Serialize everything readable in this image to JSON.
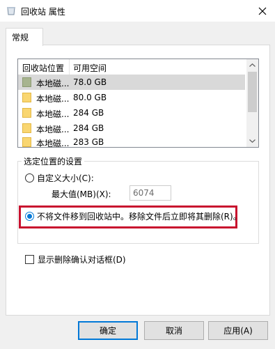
{
  "window": {
    "title": "回收站 属性",
    "icon": "recycle-bin-icon",
    "close": "close-icon"
  },
  "tabs": [
    {
      "label": "常规"
    }
  ],
  "list": {
    "columns": [
      "回收站位置",
      "可用空间"
    ],
    "rows": [
      {
        "name": "本地磁...",
        "space": "78.0 GB",
        "icon": "drive-icon",
        "selected": true
      },
      {
        "name": "本地磁...",
        "space": "80.0 GB",
        "icon": "drive-icon"
      },
      {
        "name": "本地磁...",
        "space": "284 GB",
        "icon": "drive-icon"
      },
      {
        "name": "本地磁...",
        "space": "284 GB",
        "icon": "drive-icon"
      },
      {
        "name": "本地磁...",
        "space": "283 GB",
        "icon": "drive-icon"
      }
    ]
  },
  "settings": {
    "legend": "选定位置的设置",
    "custom_size": {
      "label": "自定义大小(C):",
      "checked": false
    },
    "max_size": {
      "label": "最大值(MB)(X):",
      "value": "6074"
    },
    "delete_immediately": {
      "label": "不将文件移到回收站中。移除文件后立即将其删除(R)。",
      "checked": true
    }
  },
  "confirm_dialog": {
    "label": "显示删除确认对话框(D)",
    "checked": false
  },
  "buttons": {
    "ok": "确定",
    "cancel": "取消",
    "apply": "应用(A)"
  },
  "colors": {
    "accent": "#0078d7",
    "highlight": "#c8102e"
  }
}
